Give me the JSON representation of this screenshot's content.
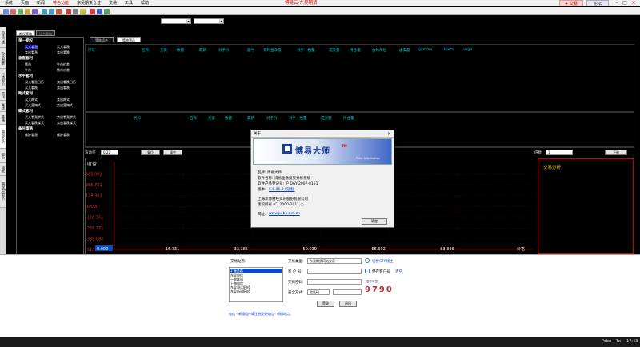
{
  "menu": {
    "items": [
      "系统",
      "页面",
      "新闻",
      "特色功能",
      "东吴期货仓位",
      "交易",
      "工具",
      "帮助"
    ],
    "active_index": 3
  },
  "app_title": "博易云-东吴期货",
  "header_buttons": {
    "trade": "+ 交易",
    "forum": "论坛"
  },
  "left_vertical_tabs": [
    "自选行情",
    "分析图表",
    "行情报价",
    "资讯",
    "画线",
    "策略",
    "期权分析",
    "报价",
    "组合",
    "期权T型报价"
  ],
  "left_panel": {
    "tabs": [
      "期权策略",
      "组合策略"
    ],
    "sections": [
      {
        "title": "单一期权",
        "items": [
          [
            "买入看涨",
            "买入看跌"
          ],
          [
            "卖出看涨",
            "卖出看跌"
          ]
        ]
      },
      {
        "title": "垂直套利",
        "items": [
          [
            "熊市",
            "牛市价差"
          ],
          [
            "牛市",
            "熊市价差"
          ]
        ]
      },
      {
        "title": "水平套利",
        "items": [
          [
            "买入看涨日历",
            "卖出看跌日历"
          ],
          [
            "买入看跌",
            "卖出看跌"
          ]
        ]
      },
      {
        "title": "跨式套利",
        "items": [
          [
            "买入跨式",
            "卖出跨式"
          ],
          [
            "买入宽跨式",
            "卖出宽跨式"
          ]
        ]
      },
      {
        "title": "蝶式套利",
        "items": [
          [
            "买入看涨蝶式",
            "卖出看涨蝶式"
          ],
          [
            "买入看跌蝶式",
            "卖出看跌蝶式"
          ]
        ]
      },
      {
        "title": "备兑策略",
        "items": [
          [
            "保护看涨",
            "保护看跌"
          ]
        ]
      }
    ]
  },
  "main_tabs": [
    "策略组合",
    "策略筛选"
  ],
  "grid_top": {
    "headers": [
      "序号",
      "名称",
      "买卖",
      "数量",
      "最新",
      "对手价",
      "盈亏",
      "权利金净值",
      "对手一档量",
      "成交量",
      "持仓量",
      "合约单位",
      "虚实度",
      "gamma",
      "theta",
      "vega"
    ]
  },
  "grid_bot": {
    "headers": [
      "代码",
      "名称",
      "买卖",
      "数量",
      "最新",
      "对手价",
      "对手一档量",
      "成交量",
      "持仓量"
    ]
  },
  "controls": {
    "rate_label": "波动率",
    "rate_value": "0.22",
    "reset": "复位",
    "clear": "清空",
    "multiplier_label": "倍数",
    "multiplier_value": "1",
    "next": "下单"
  },
  "chart": {
    "y_title": "收益",
    "y_ticks": [
      "385.002",
      "256.721",
      "128.361",
      "-0.000",
      "-128.361",
      "-256.721",
      "-385.082",
      "-513.443"
    ],
    "x_ticks": [
      "0.000",
      "16.731",
      "33.385",
      "50.039",
      "66.692",
      "83.346"
    ],
    "x_title": "价格"
  },
  "trade_analysis_title": "交易分析",
  "login": {
    "site_label": "交易站点:",
    "sites": [
      "1 服务器",
      "东吴电信",
      "一般联通",
      "上海电信",
      "东吴测试IPV6",
      "东吴新通IPV6"
    ],
    "rows": [
      {
        "label": "交易类型:",
        "value": "东吴期货网站交易"
      },
      {
        "label": "客 户 号:",
        "value": ""
      },
      {
        "label": "交易密码:",
        "value": ""
      },
      {
        "label": "安全方式:",
        "value": "验证码"
      }
    ],
    "check1": "切换CTP线主",
    "check2": "保存客户号",
    "link_clear": "清空",
    "captcha_hint": "看不清楚?",
    "captcha": "9790",
    "login_btn": "登录",
    "exit_btn": "退出",
    "footer_text": "电信 - 新通用户请注册登录电信 - 新通站点。"
  },
  "status": {
    "right1": "Pobo",
    "right2": "Tx",
    "time": "17:43"
  },
  "about": {
    "title": "关于",
    "product_big": "博易大师",
    "tm": "TM",
    "en_brand": "Pobo Information",
    "product_line": "品牌: 博易大师",
    "software_name": "软件名称: 博易金融投资分析系统",
    "register_no": "软件产品登记号: 沪 DGY-2007-0151",
    "version_label": "版本:",
    "version": "5.5.86.0 (见图)",
    "company": "上海澎博财经资讯股份有限公司",
    "copyright": "版权所有 (C) 2000-2011 ○",
    "website_label": "网址:",
    "website": "www.pobo.net.cn",
    "ok": "确定"
  }
}
